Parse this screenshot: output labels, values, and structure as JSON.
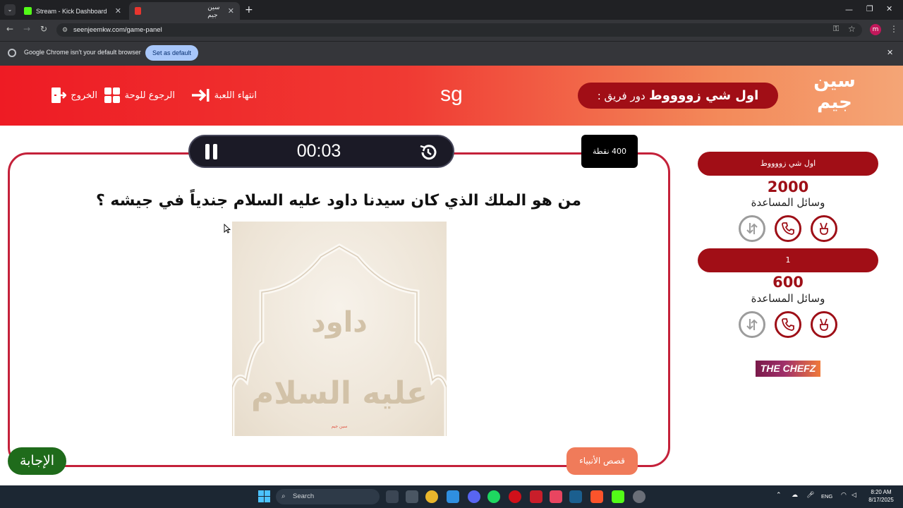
{
  "browser": {
    "tabs": [
      {
        "title": "Stream - Kick Dashboard",
        "favicon_color": "#53fc18"
      },
      {
        "title": "سين جيم",
        "favicon_color": "#e8352e"
      }
    ],
    "new_tab": "+",
    "url": "seenjeemkw.com/game-panel",
    "infobar": {
      "message": "Google Chrome isn't your default browser",
      "button": "Set as default"
    },
    "profile_initial": "m"
  },
  "header": {
    "logo_line1": "سين",
    "logo_line2": "جيم",
    "team_turn_label": "دور فريق :",
    "team_turn_name": "اول شي زووووط",
    "center_text": "sg",
    "buttons": {
      "end_game": "انتهاء اللعبة",
      "back_to_board": "الرجوع للوحة",
      "exit": "الخروج"
    }
  },
  "timer": {
    "time": "00:03"
  },
  "points_badge": "400 نقطة",
  "question": {
    "text": "من هو الملك الذي كان سيدنا داود عليه السلام جندياً في جيشه ؟",
    "image_text_line1": "داود",
    "image_text_line2": "عليه السلام",
    "image_watermark": "سين جيم"
  },
  "answer_button": "الإجابة",
  "category_button": "قصص الأنبياء",
  "teams": [
    {
      "name": "اول شي زووووط",
      "score": "2000",
      "aids_label": "وسائل المساعدة"
    },
    {
      "name": "1",
      "score": "600",
      "aids_label": "وسائل المساعدة"
    }
  ],
  "sponsor": "THE CHEFZ",
  "taskbar": {
    "search_placeholder": "Search",
    "time": "8:20 AM",
    "date": "8/17/2025",
    "lang": "ENG"
  }
}
